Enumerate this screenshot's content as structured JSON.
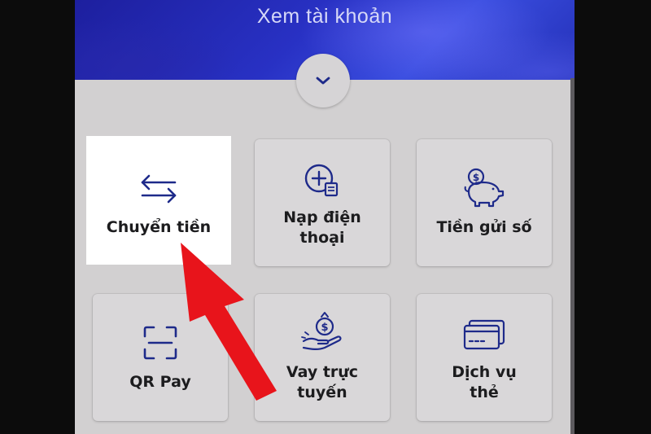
{
  "header": {
    "title": "Xem tài khoản"
  },
  "expand_button": {
    "icon": "chevron-down-icon"
  },
  "tiles": [
    {
      "label": "Chuyển tiền",
      "icon": "transfer-arrows-icon"
    },
    {
      "label_line1": "Nạp điện",
      "label_line2": "thoại",
      "icon": "phone-topup-icon"
    },
    {
      "label": "Tiền gửi số",
      "icon": "piggy-bank-icon"
    },
    {
      "label": "QR Pay",
      "icon": "qr-scan-icon"
    },
    {
      "label_line1": "Vay trực",
      "label_line2": "tuyến",
      "icon": "loan-hand-coin-icon"
    },
    {
      "label_line1": "Dịch vụ",
      "label_line2": "thẻ",
      "icon": "cards-icon"
    }
  ],
  "annotation": {
    "arrow_color": "#e8141b"
  },
  "colors": {
    "header_blue": "#2831c4",
    "icon_navy": "#1e2a8a",
    "background_gray": "#d2d0d1"
  }
}
